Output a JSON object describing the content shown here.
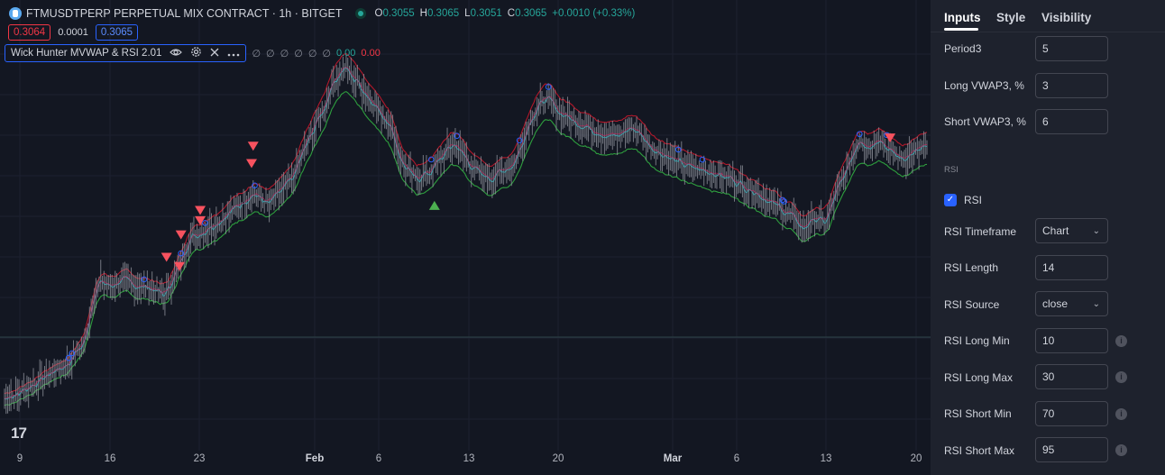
{
  "header": {
    "symbol_title": "FTMUSDTPERP PERPETUAL MIX CONTRACT · 1h · BITGET",
    "ohlc": [
      {
        "key": "O",
        "value": "0.3055"
      },
      {
        "key": "H",
        "value": "0.3065"
      },
      {
        "key": "L",
        "value": "0.3051"
      },
      {
        "key": "C",
        "value": "0.3065"
      }
    ],
    "change": "+0.0010 (+0.33%)"
  },
  "quote": {
    "bid": "0.3064",
    "spread": "0.0001",
    "ask": "0.3065"
  },
  "indicator": {
    "name": "Wick Hunter MVWAP & RSI 2.01",
    "placeholders": [
      "∅",
      "∅",
      "∅",
      "∅",
      "∅",
      "∅"
    ],
    "value_green": "0.00",
    "value_red": "0.00"
  },
  "watermark": "17",
  "time_axis": [
    {
      "label": "9",
      "bold": false
    },
    {
      "label": "16",
      "bold": false
    },
    {
      "label": "23",
      "bold": false
    },
    {
      "label": "Feb",
      "bold": true
    },
    {
      "label": "6",
      "bold": false
    },
    {
      "label": "13",
      "bold": false
    },
    {
      "label": "20",
      "bold": false
    },
    {
      "label": "Mar",
      "bold": true
    },
    {
      "label": "6",
      "bold": false
    },
    {
      "label": "13",
      "bold": false
    },
    {
      "label": "20",
      "bold": false
    }
  ],
  "chart_data": {
    "type": "line",
    "price_path": [
      [
        0,
        0.145
      ],
      [
        10,
        0.15
      ],
      [
        20,
        0.16
      ],
      [
        30,
        0.17
      ],
      [
        40,
        0.18
      ],
      [
        50,
        0.2
      ],
      [
        55,
        0.24
      ],
      [
        60,
        0.26
      ],
      [
        65,
        0.255
      ],
      [
        75,
        0.26
      ],
      [
        90,
        0.253
      ],
      [
        100,
        0.246
      ],
      [
        108,
        0.27
      ],
      [
        115,
        0.3
      ],
      [
        125,
        0.31
      ],
      [
        140,
        0.325
      ],
      [
        155,
        0.345
      ],
      [
        165,
        0.335
      ],
      [
        180,
        0.36
      ],
      [
        190,
        0.4
      ],
      [
        200,
        0.43
      ],
      [
        205,
        0.455
      ],
      [
        212,
        0.468
      ],
      [
        220,
        0.455
      ],
      [
        232,
        0.43
      ],
      [
        240,
        0.415
      ],
      [
        248,
        0.375
      ],
      [
        255,
        0.36
      ],
      [
        265,
        0.365
      ],
      [
        280,
        0.395
      ],
      [
        295,
        0.365
      ],
      [
        305,
        0.362
      ],
      [
        318,
        0.375
      ],
      [
        330,
        0.425
      ],
      [
        338,
        0.438
      ],
      [
        350,
        0.42
      ],
      [
        365,
        0.41
      ],
      [
        380,
        0.4
      ],
      [
        392,
        0.41
      ],
      [
        405,
        0.39
      ],
      [
        415,
        0.38
      ],
      [
        430,
        0.37
      ],
      [
        445,
        0.365
      ],
      [
        455,
        0.358
      ],
      [
        470,
        0.345
      ],
      [
        480,
        0.334
      ],
      [
        490,
        0.325
      ],
      [
        498,
        0.312
      ],
      [
        505,
        0.32
      ],
      [
        512,
        0.318
      ],
      [
        520,
        0.35
      ],
      [
        527,
        0.375
      ],
      [
        533,
        0.4
      ],
      [
        539,
        0.39
      ],
      [
        545,
        0.4
      ],
      [
        553,
        0.385
      ],
      [
        560,
        0.38
      ],
      [
        575,
        0.39
      ]
    ],
    "bearish_signals": [
      [
        101,
        0.283
      ],
      [
        109,
        0.274
      ],
      [
        110,
        0.305
      ],
      [
        122,
        0.319
      ],
      [
        122,
        0.329
      ],
      [
        154,
        0.375
      ],
      [
        155,
        0.392
      ],
      [
        552,
        0.4
      ]
    ],
    "bullish_signals": [
      [
        268,
        0.334
      ]
    ]
  },
  "colors": {
    "background": "#131722",
    "price": "#9598a1",
    "upper_band": "#b2182b",
    "lower_band": "#2e9e3e",
    "vwap_teal": "#3fb6c2",
    "vwap_pink": "#e91e63",
    "bear_marker": "#f7525f",
    "bull_marker": "#4caf50",
    "circle_marker": "#2962ff"
  },
  "panel": {
    "tabs": [
      "Inputs",
      "Style",
      "Visibility"
    ],
    "rows_top": [
      {
        "label": "Period3",
        "value": "5"
      },
      {
        "label": "Long VWAP3, %",
        "value": "3"
      },
      {
        "label": "Short VWAP3, %",
        "value": "6"
      }
    ],
    "section_label": "RSI",
    "rsi_checkbox_label": "RSI",
    "rows_rsi": [
      {
        "label": "RSI Timeframe",
        "value": "Chart"
      },
      {
        "label": "RSI Length",
        "value": "14"
      },
      {
        "label": "RSI Source",
        "value": "close"
      },
      {
        "label": "RSI Long Min",
        "value": "10"
      },
      {
        "label": "RSI Long Max",
        "value": "30"
      },
      {
        "label": "RSI Short Min",
        "value": "70"
      },
      {
        "label": "RSI Short Max",
        "value": "95"
      }
    ]
  }
}
